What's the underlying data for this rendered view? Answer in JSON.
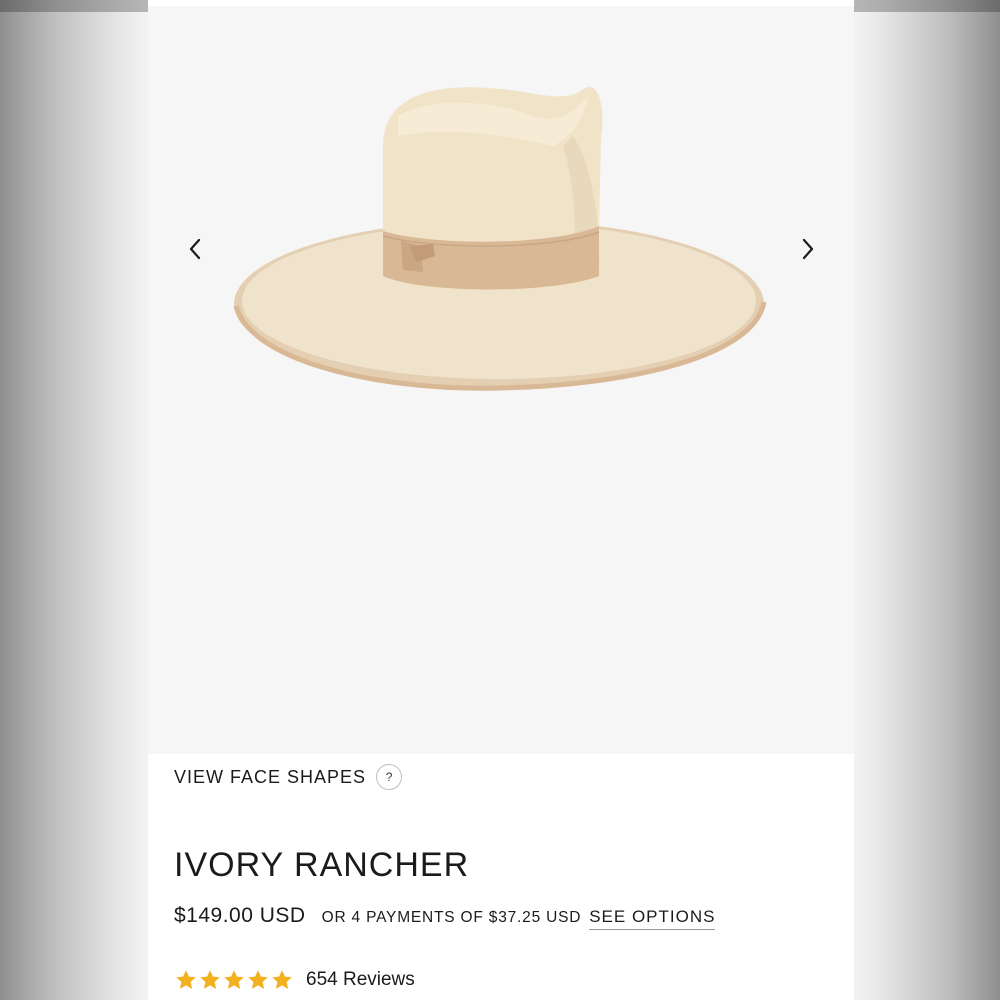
{
  "gallery": {
    "image_alt": "hat-image",
    "prev_icon": "chevron-left-icon",
    "next_icon": "chevron-right-icon"
  },
  "face_shapes": {
    "label": "VIEW FACE SHAPES",
    "help_symbol": "?"
  },
  "product": {
    "title": "IVORY RANCHER",
    "price": "$149.00 USD",
    "installments": "OR 4 PAYMENTS OF $37.25 USD",
    "see_options": "SEE OPTIONS"
  },
  "reviews": {
    "rating": 5,
    "count_label": "654 Reviews",
    "star_color": "#f2b01e"
  },
  "colors": {
    "hat_felt": "#efe3cc",
    "hat_band": "#d9b896",
    "gallery_bg": "#f6f6f6",
    "text": "#1b1b1b"
  }
}
